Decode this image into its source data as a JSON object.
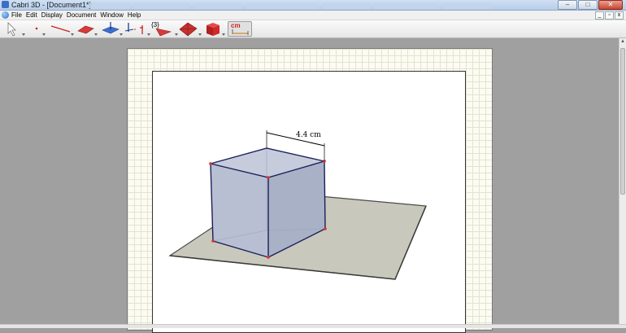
{
  "window": {
    "title": "Cabri 3D - [Document1*]",
    "controls": {
      "minimize": "–",
      "maximize": "□",
      "close": "✕"
    }
  },
  "menubar": {
    "items": [
      "File",
      "Edit",
      "Display",
      "Document",
      "Window",
      "Help"
    ],
    "mdi_controls": [
      "_",
      "▫",
      "x"
    ]
  },
  "toolbar": {
    "tools": [
      {
        "name": "manipulation",
        "icon": "pointer-arrow-icon"
      },
      {
        "name": "points",
        "icon": "point-icon"
      },
      {
        "name": "curves",
        "icon": "line-icon"
      },
      {
        "name": "surfaces",
        "icon": "plane-icon"
      },
      {
        "name": "relative-constructions",
        "icon": "perpendicular-icon"
      },
      {
        "name": "regular-polygons",
        "icon": "polygon-icon"
      },
      {
        "name": "transformations",
        "icon": "transform-icon"
      },
      {
        "name": "polyhedra",
        "icon": "triangle-icon"
      },
      {
        "name": "regular-polyhedra",
        "icon": "polyhedron-icon"
      },
      {
        "name": "solids",
        "icon": "cube-icon"
      }
    ],
    "set_label": "{3}",
    "units_label": "cm"
  },
  "colors": {
    "plane": "#c9c8bc",
    "cube_face": "#b7bdd0",
    "edge": "#1a1f5a",
    "vertex": "#d8342b",
    "workspace": "#a0a0a0"
  },
  "document": {
    "measurement_label": "4.4 cm"
  }
}
